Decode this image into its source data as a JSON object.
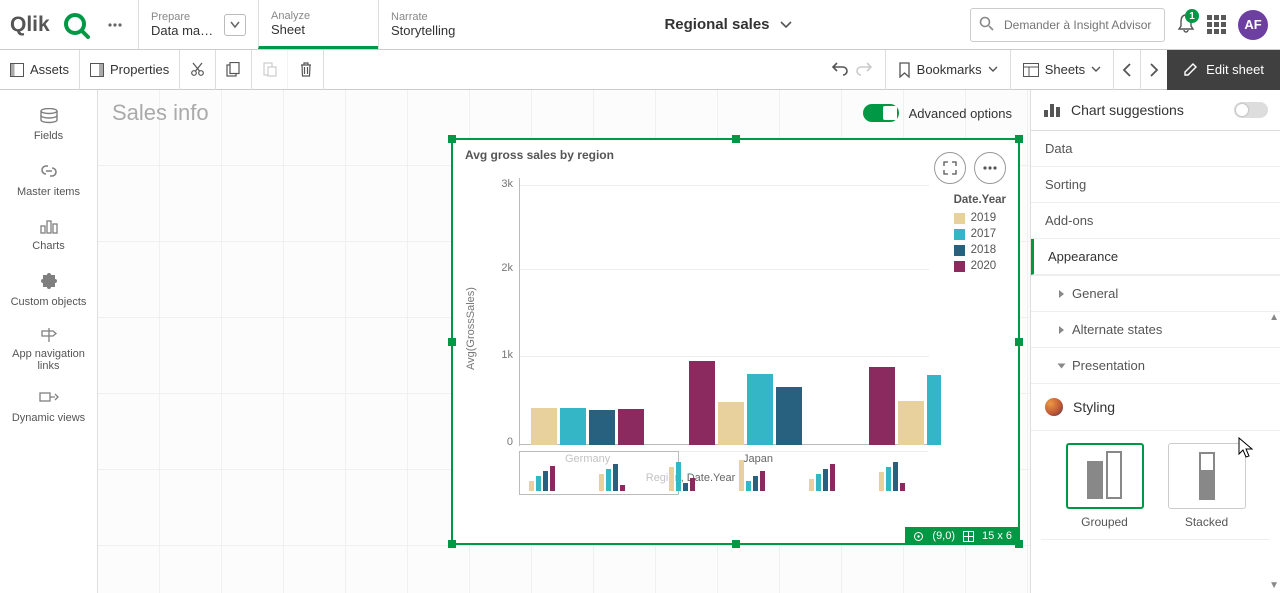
{
  "brand": {
    "name": "Qlik"
  },
  "nav": {
    "prepare": {
      "label": "Prepare",
      "value": "Data man..."
    },
    "analyze": {
      "label": "Analyze",
      "value": "Sheet"
    },
    "narrate": {
      "label": "Narrate",
      "value": "Storytelling"
    }
  },
  "app_title": "Regional sales",
  "search": {
    "placeholder": "Demander à Insight Advisor"
  },
  "notif_count": "1",
  "avatar": "AF",
  "toolbar2": {
    "assets": "Assets",
    "properties": "Properties",
    "bookmarks": "Bookmarks",
    "sheets": "Sheets",
    "edit": "Edit sheet"
  },
  "left_rail": {
    "fields": "Fields",
    "master": "Master items",
    "charts": "Charts",
    "custom": "Custom objects",
    "appnav": "App navigation links",
    "dynamic": "Dynamic views"
  },
  "sheet_title": "Sales info",
  "adv_opt": "Advanced options",
  "chart": {
    "title": "Avg gross sales by region",
    "y_label": "Avg(GrossSales)",
    "x_label": "Region, Date.Year",
    "legend_title": "Date.Year",
    "legend": [
      {
        "label": "2019",
        "color": "#E8D19C"
      },
      {
        "label": "2017",
        "color": "#34B6C6"
      },
      {
        "label": "2018",
        "color": "#28607F"
      },
      {
        "label": "2020",
        "color": "#8A2A5F"
      }
    ],
    "y_ticks": [
      "3k",
      "2k",
      "1k",
      "0"
    ],
    "categories": [
      "Germany",
      "Japan"
    ],
    "coord_badge": {
      "pos": "(9,0)",
      "grid": "15 x 6"
    }
  },
  "chart_data": {
    "type": "bar",
    "title": "Avg gross sales by region",
    "xlabel": "Region, Date.Year",
    "ylabel": "Avg(GrossSales)",
    "ylim": [
      0,
      3000
    ],
    "categories": [
      "Germany",
      "Japan"
    ],
    "series": [
      {
        "name": "2019",
        "color": "#E8D19C",
        "values": [
          430,
          500
        ]
      },
      {
        "name": "2017",
        "color": "#34B6C6",
        "values": [
          420,
          820
        ]
      },
      {
        "name": "2018",
        "color": "#28607F",
        "values": [
          400,
          670
        ]
      },
      {
        "name": "2020",
        "color": "#8A2A5F",
        "values": [
          410,
          970
        ]
      }
    ],
    "legend_position": "right",
    "grid": true
  },
  "right_panel": {
    "suggestions": "Chart suggestions",
    "sections": {
      "data": "Data",
      "sorting": "Sorting",
      "addons": "Add-ons",
      "appearance": "Appearance"
    },
    "appearance_items": {
      "general": "General",
      "alt": "Alternate states",
      "presentation": "Presentation"
    },
    "styling": "Styling",
    "grouped": "Grouped",
    "stacked": "Stacked"
  }
}
